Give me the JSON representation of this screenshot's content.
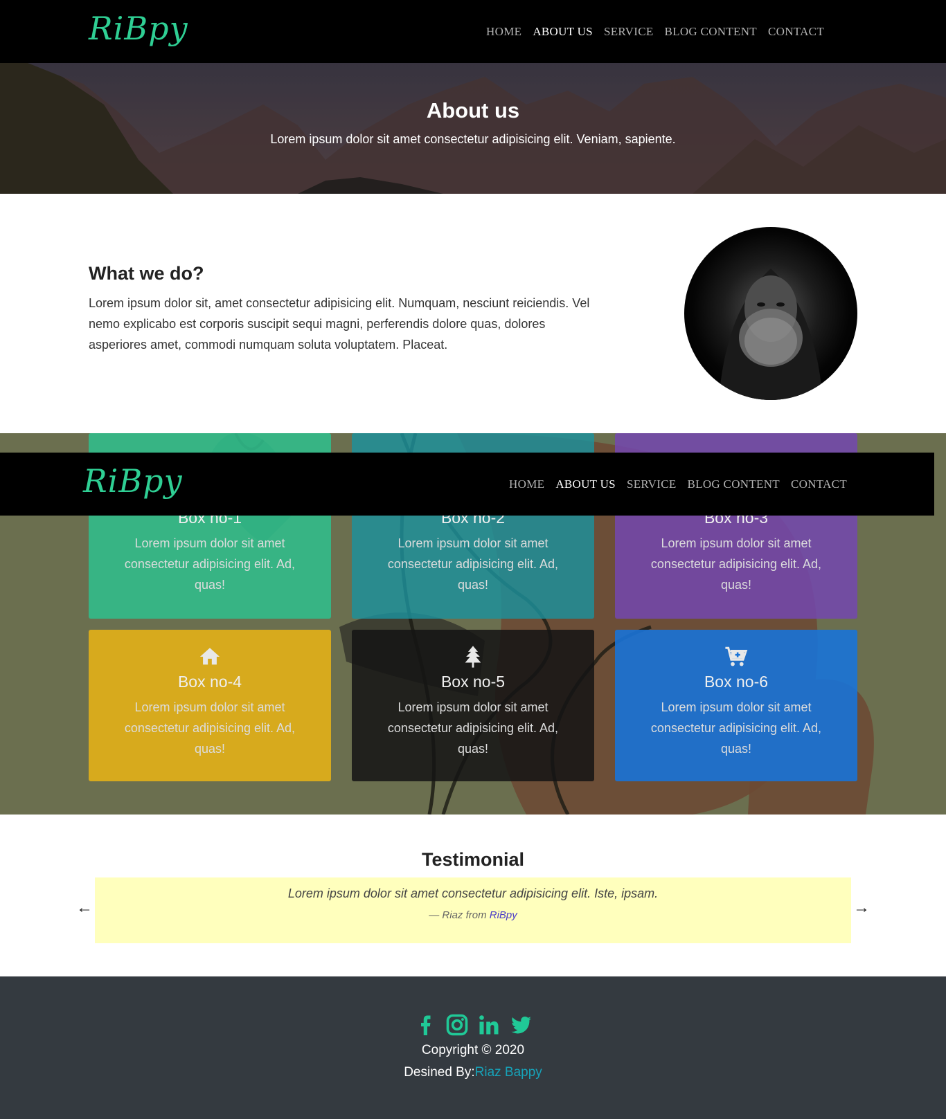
{
  "brand": "RiBpy",
  "nav": [
    "HOME",
    "ABOUT US",
    "SERVICE",
    "BLOG CONTENT",
    "CONTACT"
  ],
  "nav_active_index": 1,
  "hero": {
    "title": "About us",
    "subtitle": "Lorem ipsum dolor sit amet consectetur adipisicing elit. Veniam, sapiente."
  },
  "about": {
    "heading": "What we do?",
    "text": "Lorem ipsum dolor sit, amet consectetur adipisicing elit. Numquam, nesciunt reiciendis. Vel nemo explicabo est corporis suscipit sequi magni, perferendis dolore quas, dolores asperiores amet, commodi numquam soluta voluptatem. Placeat."
  },
  "boxes": [
    {
      "title": "Box no-1",
      "text": "Lorem ipsum dolor sit amet consectetur adipisicing elit. Ad, quas!",
      "color": "#30be8c"
    },
    {
      "title": "Box no-2",
      "text": "Lorem ipsum dolor sit amet consectetur adipisicing elit. Ad, quas!",
      "color": "#1c919c"
    },
    {
      "title": "Box no-3",
      "text": "Lorem ipsum dolor sit amet consectetur adipisicing elit. Ad, quas!",
      "color": "#7348af"
    },
    {
      "title": "Box no-4",
      "text": "Lorem ipsum dolor sit amet consectetur adipisicing elit. Ad, quas!",
      "icon": "home-icon",
      "color": "#e1af19"
    },
    {
      "title": "Box no-5",
      "text": "Lorem ipsum dolor sit amet consectetur adipisicing elit. Ad, quas!",
      "icon": "tree-icon",
      "color": "#141414"
    },
    {
      "title": "Box no-6",
      "text": "Lorem ipsum dolor sit amet consectetur adipisicing elit. Ad, quas!",
      "icon": "cart-plus-icon",
      "color": "#1973d7"
    }
  ],
  "testimonial": {
    "title": "Testimonial",
    "quote": "Lorem ipsum dolor sit amet consectetur adipisicing elit. Iste, ipsam.",
    "author_prefix": "— Riaz from",
    "author_source": "RiBpy",
    "prev": "←",
    "next": "→"
  },
  "footer": {
    "socials": [
      "facebook-icon",
      "instagram-icon",
      "linkedin-icon",
      "twitter-icon"
    ],
    "social_color": "#20c997",
    "copyright": "Copyright © 2020",
    "designed_prefix": "Desined By:",
    "designed_author": "Riaz Bappy"
  }
}
